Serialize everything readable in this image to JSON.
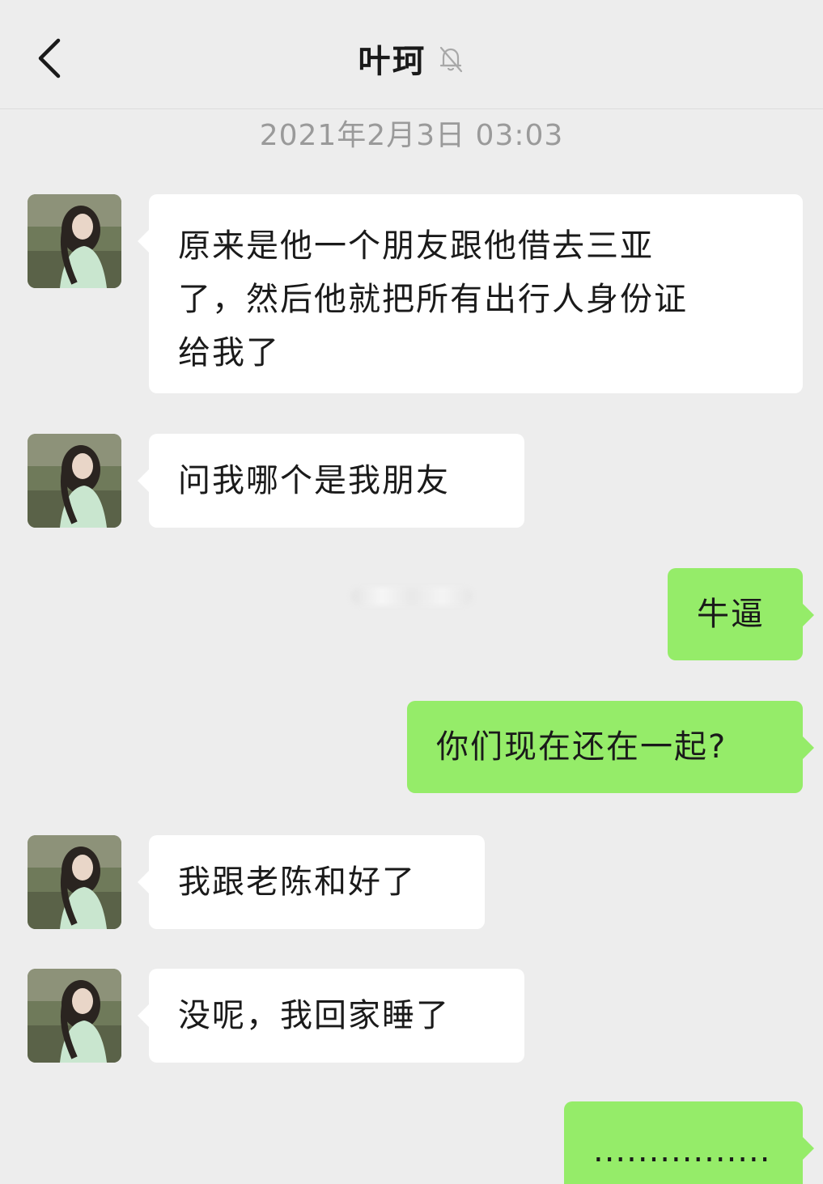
{
  "header": {
    "title": "叶珂",
    "back_icon": "chevron-left-icon",
    "mute_icon": "bell-muted-icon"
  },
  "timestamp": "2021年2月3日 03:03",
  "colors": {
    "background": "#ededed",
    "incoming_bubble": "#ffffff",
    "outgoing_bubble": "#95ec69"
  },
  "messages": [
    {
      "side": "left",
      "lines": [
        "原来是他一个朋友跟他借去三亚",
        "了，然后他就把所有出行人身份证",
        "给我了"
      ]
    },
    {
      "side": "left",
      "text": "问我哪个是我朋友"
    },
    {
      "side": "right",
      "text": "牛逼"
    },
    {
      "side": "right",
      "text": "你们现在还在一起?"
    },
    {
      "side": "left",
      "text": "我跟老陈和好了"
    },
    {
      "side": "left",
      "text": "没呢，我回家睡了"
    },
    {
      "side": "right",
      "text": "................"
    }
  ]
}
